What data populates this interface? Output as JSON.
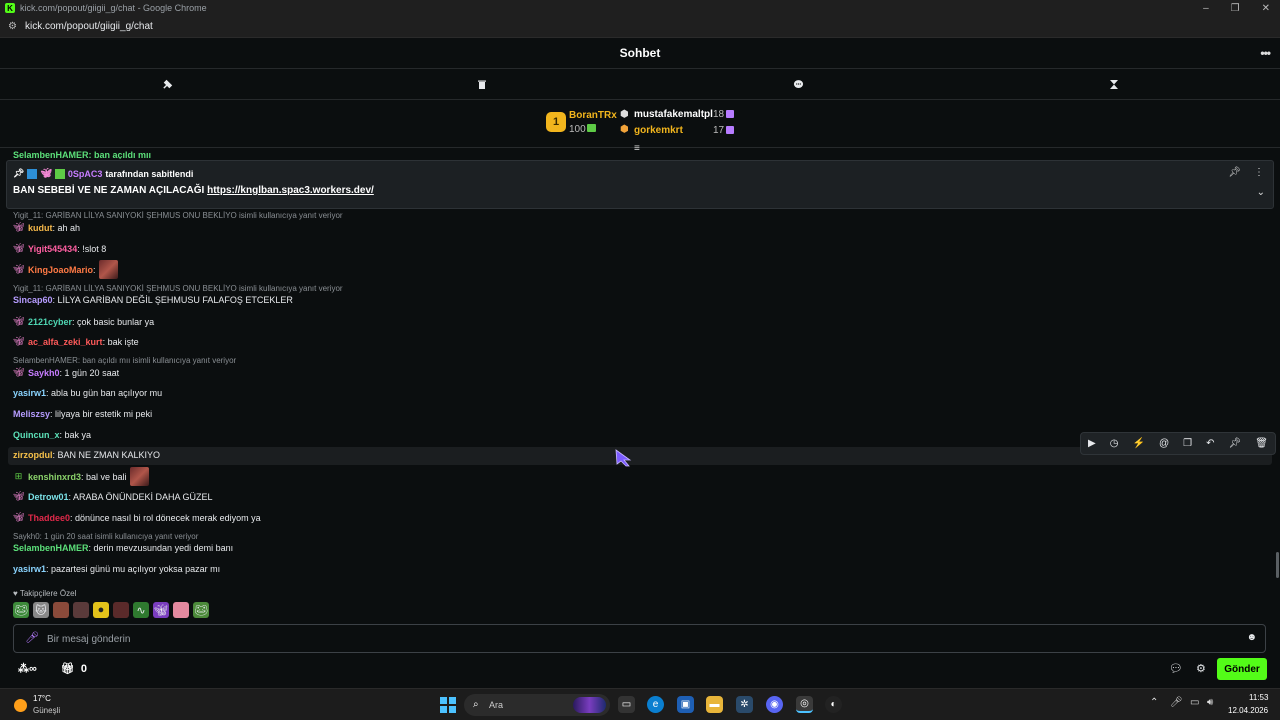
{
  "browser": {
    "window_title": "kick.com/popout/giigii_g/chat - Google Chrome",
    "url": "kick.com/popout/giigii_g/chat",
    "controls": [
      "–",
      "❐",
      "✕"
    ]
  },
  "chat": {
    "header_title": "Sohbet",
    "more_label": "•••",
    "tools": [
      "hammer-icon",
      "trash-icon",
      "chat-bubble-icon",
      "hourglass-icon"
    ],
    "leaderboard": {
      "top": {
        "name": "BoranTRx",
        "amount": "100",
        "rank": "1"
      },
      "entries": [
        {
          "name": "mustafakemaltpl",
          "amount": "18"
        },
        {
          "name": "gorkemkrt",
          "amount": "17"
        }
      ]
    },
    "cutoff_message": "SelambenHAMER: ban açıldı mıı",
    "pinned": {
      "pinned_by_user": "0SpAC3",
      "pinned_by_text": "tarafından sabitlendi",
      "message_prefix": "BAN SEBEBİ VE NE ZAMAN AÇILACAĞI ",
      "message_link": "https://knglban.spac3.workers.dev/"
    },
    "messages": [
      {
        "reply": "Yigit_11: GARİBAN LİLYA SANIYOKİ ŞEHMUS ONU BEKLİYO isimli kullanıcıya yanıt veriyor"
      },
      {
        "user": "kudut",
        "color": "#f5b84a",
        "text": ": ah ah"
      },
      {
        "user": "Yigit545434",
        "color": "#ff5fa2",
        "text": ": !slot 8"
      },
      {
        "user": "KingJoaoMario",
        "color": "#ff7a45",
        "text": ":"
      },
      {
        "reply": "Yigit_11: GARİBAN LİLYA SANIYOKİ ŞEHMUS ONU BEKLİYO isimli kullanıcıya yanıt veriyor"
      },
      {
        "user": "Sincap60",
        "color": "#b69cff",
        "text": ": LİLYA GARİBAN DEĞİL ŞEHMUSU FALAFOŞ ETCEKLER"
      },
      {
        "user": "2121cyber",
        "color": "#4fd6b3",
        "text": ": çok basic bunlar ya"
      },
      {
        "user": "ac_alfa_zeki_kurt",
        "color": "#ff5a5a",
        "text": ": bak işte"
      },
      {
        "reply": "SelambenHAMER: ban açıldı mıı isimli kullanıcıya yanıt veriyor"
      },
      {
        "user": "Saykh0",
        "color": "#c77dff",
        "text": ": 1 gün 20 saat"
      },
      {
        "user": "yasirw1",
        "color": "#8ad4ff",
        "text": ": abla bu gün ban açılıyor mu"
      },
      {
        "user": "Meliszsy",
        "color": "#b69cff",
        "text": ": lilyaya bir estetik mi peki"
      },
      {
        "user": "Quincun_x",
        "color": "#5ce0b8",
        "text": ": bak ya"
      },
      {
        "user": "zirzopdul",
        "color": "#f5c04a",
        "text": ": BAN NE ZMAN KALKIYO"
      },
      {
        "user": "kenshinxrd3",
        "color": "#8bd36b",
        "text": ": bal ve bali"
      },
      {
        "user": "Detrow01",
        "color": "#7ae0e6",
        "text": ": ARABA ÖNÜNDEKİ DAHA GÜZEL"
      },
      {
        "user": "Thaddee0",
        "color": "#e0294a",
        "text": ": dönünce nasıl bi rol dönecek merak ediyom ya"
      },
      {
        "reply": "Saykh0: 1 gün 20 saat isimli kullanıcıya yanıt veriyor"
      },
      {
        "user": "SelambenHAMER",
        "color": "#5ce07a",
        "text": ": derin mevzusundan yedi demi banı"
      },
      {
        "user": "yasirw1",
        "color": "#8ad4ff",
        "text": ": pazartesi günü mu açılıyor yoksa pazar mı"
      }
    ],
    "followers_label": "Takipçilere Özel",
    "input_placeholder": "Bir mesaj gönderin",
    "footer_count": "0",
    "send_label": "Gönder"
  },
  "taskbar": {
    "weather_temp": "17°C",
    "weather_cond": "Güneşli",
    "search_label": "Ara",
    "time": "11:53",
    "date": "12.04.2026"
  },
  "colors": {
    "accent": "#53fc18",
    "background": "#0b0e0f",
    "gold": "#f2b51d",
    "leader_name_1": "#f2b51d",
    "leader_name_2": "#ffffff",
    "leader_name_3": "#f2b51d"
  }
}
